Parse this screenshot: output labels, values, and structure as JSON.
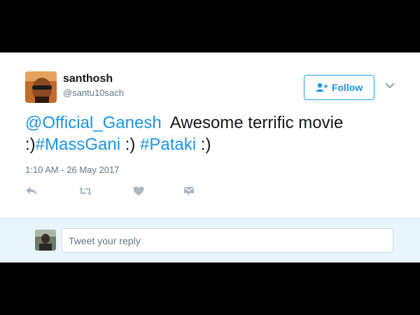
{
  "tweet": {
    "author_name": "santhosh",
    "author_handle": "@santu10sach",
    "follow_label": "Follow",
    "text_parts": {
      "mention": "@Official_Ganesh",
      "text1": "  Awesome terrific movie",
      "text2": ":)",
      "hashtag1": "#MassGani",
      "text3": " :) ",
      "hashtag2": "#Pataki",
      "text4": " :)"
    },
    "timestamp": "1:10 AM - 26 May 2017"
  },
  "actions": {
    "icons": [
      "reply-icon",
      "retweet-icon",
      "like-icon",
      "direct-message-icon"
    ]
  },
  "reply": {
    "placeholder": "Tweet your reply"
  },
  "colors": {
    "link": "#1b95e0",
    "background": "#000000",
    "reply_bar": "#e8f5fd"
  }
}
